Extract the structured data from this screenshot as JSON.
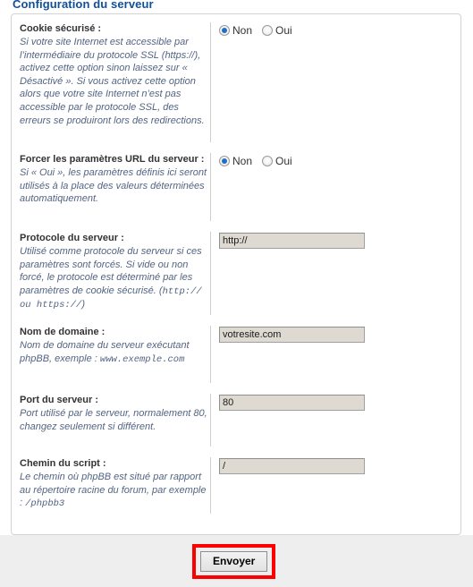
{
  "panel": {
    "title": "Configuration du serveur"
  },
  "fields": [
    {
      "label": "Cookie sécurisé :",
      "desc_main": "Si votre site Internet est accessible par l’intermédiaire du protocole SSL (https://), activez cette option sinon laissez sur « Désactivé ». Si vous activez cette option alors que votre site Internet n’est pas accessible par le protocole SSL, des erreurs se produiront lors des redirections.",
      "desc_mono": "",
      "control": "radio",
      "options": [
        {
          "label": "Non",
          "checked": true
        },
        {
          "label": "Oui",
          "checked": false
        }
      ]
    },
    {
      "label": "Forcer les paramètres URL du serveur :",
      "desc_main": "Si « Oui », les paramètres définis ici seront utilisés à la place des valeurs déterminées automatiquement.",
      "desc_mono": "",
      "control": "radio",
      "options": [
        {
          "label": "Non",
          "checked": true
        },
        {
          "label": "Oui",
          "checked": false
        }
      ]
    },
    {
      "label": "Protocole du serveur :",
      "desc_main": "Utilisé comme protocole du serveur si ces paramètres sont forcés. Si vide ou non forcé, le protocole est déterminé par les paramètres de cookie sécurisé. (",
      "desc_mono": "http:// ou https://",
      "desc_tail": ")",
      "control": "text",
      "value": "http://"
    },
    {
      "label": "Nom de domaine :",
      "desc_main": "Nom de domaine du serveur exécutant phpBB, exemple : ",
      "desc_mono": "www.exemple.com",
      "desc_tail": "",
      "control": "text",
      "value": "votresite.com"
    },
    {
      "label": "Port du serveur :",
      "desc_main": "Port utilisé par le serveur, normalement 80, changez seulement si différent.",
      "desc_mono": "",
      "control": "text",
      "value": "80"
    },
    {
      "label": "Chemin du script :",
      "desc_main": "Le chemin où phpBB est situé par rapport au répertoire racine du forum, par exemple : ",
      "desc_mono": "/phpbb3",
      "desc_tail": "",
      "control": "text",
      "value": "/"
    }
  ],
  "submit": {
    "label": "Envoyer",
    "highlight_color": "#fc0000"
  }
}
